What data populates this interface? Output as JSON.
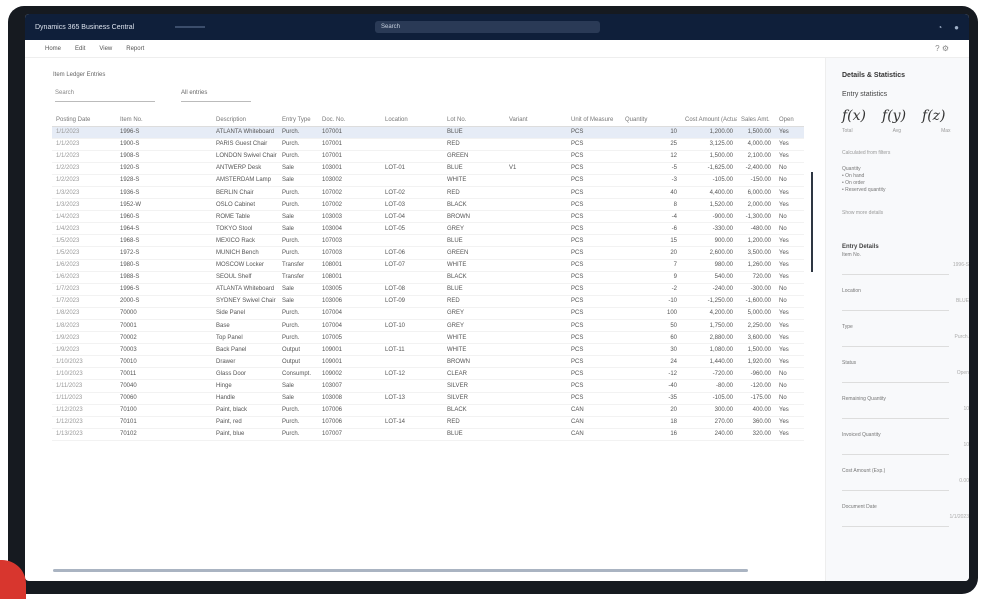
{
  "titlebar": {
    "app_name": "Dynamics 365 Business Central",
    "search_placeholder": "Search"
  },
  "menubar": {
    "items": [
      "Home",
      "Edit",
      "View",
      "Report"
    ],
    "right_icons": "? ⚙"
  },
  "page": {
    "caption": "Item Ledger Entries",
    "filter_search": "Search",
    "filter_view": "All entries"
  },
  "grid": {
    "columns": [
      "Posting Date",
      "Item No.",
      "Description",
      "Entry Type",
      "Doc. No.",
      "Location",
      "Lot No.",
      "Variant",
      "Unit of Measure",
      "Quantity",
      "Cost Amount (Actual)",
      "Sales Amt.",
      "Open"
    ],
    "rows": [
      [
        "1/1/2023",
        "1996-S",
        "ATLANTA Whiteboard",
        "Purch.",
        "107001",
        "",
        "BLUE",
        "",
        "PCS",
        "10",
        "1,200.00",
        "1,500.00",
        "Yes"
      ],
      [
        "1/1/2023",
        "1900-S",
        "PARIS Guest Chair",
        "Purch.",
        "107001",
        "",
        "RED",
        "",
        "PCS",
        "25",
        "3,125.00",
        "4,000.00",
        "Yes"
      ],
      [
        "1/1/2023",
        "1908-S",
        "LONDON Swivel Chair",
        "Purch.",
        "107001",
        "",
        "GREEN",
        "",
        "PCS",
        "12",
        "1,500.00",
        "2,100.00",
        "Yes"
      ],
      [
        "1/2/2023",
        "1920-S",
        "ANTWERP Desk",
        "Sale",
        "103001",
        "LOT-01",
        "BLUE",
        "V1",
        "PCS",
        "-5",
        "-1,625.00",
        "-2,400.00",
        "No"
      ],
      [
        "1/2/2023",
        "1928-S",
        "AMSTERDAM Lamp",
        "Sale",
        "103002",
        "",
        "WHITE",
        "",
        "PCS",
        "-3",
        "-105.00",
        "-150.00",
        "No"
      ],
      [
        "1/3/2023",
        "1936-S",
        "BERLIN Chair",
        "Purch.",
        "107002",
        "LOT-02",
        "RED",
        "",
        "PCS",
        "40",
        "4,400.00",
        "6,000.00",
        "Yes"
      ],
      [
        "1/3/2023",
        "1952-W",
        "OSLO Cabinet",
        "Purch.",
        "107002",
        "LOT-03",
        "BLACK",
        "",
        "PCS",
        "8",
        "1,520.00",
        "2,000.00",
        "Yes"
      ],
      [
        "1/4/2023",
        "1960-S",
        "ROME Table",
        "Sale",
        "103003",
        "LOT-04",
        "BROWN",
        "",
        "PCS",
        "-4",
        "-900.00",
        "-1,300.00",
        "No"
      ],
      [
        "1/4/2023",
        "1964-S",
        "TOKYO Stool",
        "Sale",
        "103004",
        "LOT-05",
        "GREY",
        "",
        "PCS",
        "-6",
        "-330.00",
        "-480.00",
        "No"
      ],
      [
        "1/5/2023",
        "1968-S",
        "MEXICO Rack",
        "Purch.",
        "107003",
        "",
        "BLUE",
        "",
        "PCS",
        "15",
        "900.00",
        "1,200.00",
        "Yes"
      ],
      [
        "1/5/2023",
        "1972-S",
        "MUNICH Bench",
        "Purch.",
        "107003",
        "LOT-06",
        "GREEN",
        "",
        "PCS",
        "20",
        "2,600.00",
        "3,500.00",
        "Yes"
      ],
      [
        "1/6/2023",
        "1980-S",
        "MOSCOW Locker",
        "Transfer",
        "108001",
        "LOT-07",
        "WHITE",
        "",
        "PCS",
        "7",
        "980.00",
        "1,260.00",
        "Yes"
      ],
      [
        "1/6/2023",
        "1988-S",
        "SEOUL Shelf",
        "Transfer",
        "108001",
        "",
        "BLACK",
        "",
        "PCS",
        "9",
        "540.00",
        "720.00",
        "Yes"
      ],
      [
        "1/7/2023",
        "1996-S",
        "ATLANTA Whiteboard",
        "Sale",
        "103005",
        "LOT-08",
        "BLUE",
        "",
        "PCS",
        "-2",
        "-240.00",
        "-300.00",
        "No"
      ],
      [
        "1/7/2023",
        "2000-S",
        "SYDNEY Swivel Chair",
        "Sale",
        "103006",
        "LOT-09",
        "RED",
        "",
        "PCS",
        "-10",
        "-1,250.00",
        "-1,600.00",
        "No"
      ],
      [
        "1/8/2023",
        "70000",
        "Side Panel",
        "Purch.",
        "107004",
        "",
        "GREY",
        "",
        "PCS",
        "100",
        "4,200.00",
        "5,000.00",
        "Yes"
      ],
      [
        "1/8/2023",
        "70001",
        "Base",
        "Purch.",
        "107004",
        "LOT-10",
        "GREY",
        "",
        "PCS",
        "50",
        "1,750.00",
        "2,250.00",
        "Yes"
      ],
      [
        "1/9/2023",
        "70002",
        "Top Panel",
        "Purch.",
        "107005",
        "",
        "WHITE",
        "",
        "PCS",
        "60",
        "2,880.00",
        "3,600.00",
        "Yes"
      ],
      [
        "1/9/2023",
        "70003",
        "Back Panel",
        "Output",
        "109001",
        "LOT-11",
        "WHITE",
        "",
        "PCS",
        "30",
        "1,080.00",
        "1,500.00",
        "Yes"
      ],
      [
        "1/10/2023",
        "70010",
        "Drawer",
        "Output",
        "109001",
        "",
        "BROWN",
        "",
        "PCS",
        "24",
        "1,440.00",
        "1,920.00",
        "Yes"
      ],
      [
        "1/10/2023",
        "70011",
        "Glass Door",
        "Consumpt.",
        "109002",
        "LOT-12",
        "CLEAR",
        "",
        "PCS",
        "-12",
        "-720.00",
        "-960.00",
        "No"
      ],
      [
        "1/11/2023",
        "70040",
        "Hinge",
        "Sale",
        "103007",
        "",
        "SILVER",
        "",
        "PCS",
        "-40",
        "-80.00",
        "-120.00",
        "No"
      ],
      [
        "1/11/2023",
        "70060",
        "Handle",
        "Sale",
        "103008",
        "LOT-13",
        "SILVER",
        "",
        "PCS",
        "-35",
        "-105.00",
        "-175.00",
        "No"
      ],
      [
        "1/12/2023",
        "70100",
        "Paint, black",
        "Purch.",
        "107006",
        "",
        "BLACK",
        "",
        "CAN",
        "20",
        "300.00",
        "400.00",
        "Yes"
      ],
      [
        "1/12/2023",
        "70101",
        "Paint, red",
        "Purch.",
        "107006",
        "LOT-14",
        "RED",
        "",
        "CAN",
        "18",
        "270.00",
        "360.00",
        "Yes"
      ],
      [
        "1/13/2023",
        "70102",
        "Paint, blue",
        "Purch.",
        "107007",
        "",
        "BLUE",
        "",
        "CAN",
        "16",
        "240.00",
        "320.00",
        "Yes"
      ]
    ]
  },
  "panel": {
    "title": "Details & Statistics",
    "subtitle": "Entry statistics",
    "formulas": [
      "f(x)",
      "f(y)",
      "f(z)"
    ],
    "formula_labels": [
      "Total",
      "Avg",
      "Max"
    ],
    "line1": "Calculated from filters",
    "list": [
      "Quantity",
      "• On hand",
      "• On order",
      "• Reserved quantity"
    ],
    "line2": "Show more details",
    "section": "Entry Details",
    "props": [
      {
        "label": "Item No.",
        "value": "1996-S"
      },
      {
        "label": "Location",
        "value": "BLUE"
      },
      {
        "label": "Type",
        "value": "Purch."
      },
      {
        "label": "Status",
        "value": "Open"
      },
      {
        "label": "Remaining Quantity",
        "value": "10"
      },
      {
        "label": "Invoiced Quantity",
        "value": "10"
      },
      {
        "label": "Cost Amount (Exp.)",
        "value": "0.00"
      },
      {
        "label": "Document Date",
        "value": "1/1/2023"
      }
    ]
  }
}
